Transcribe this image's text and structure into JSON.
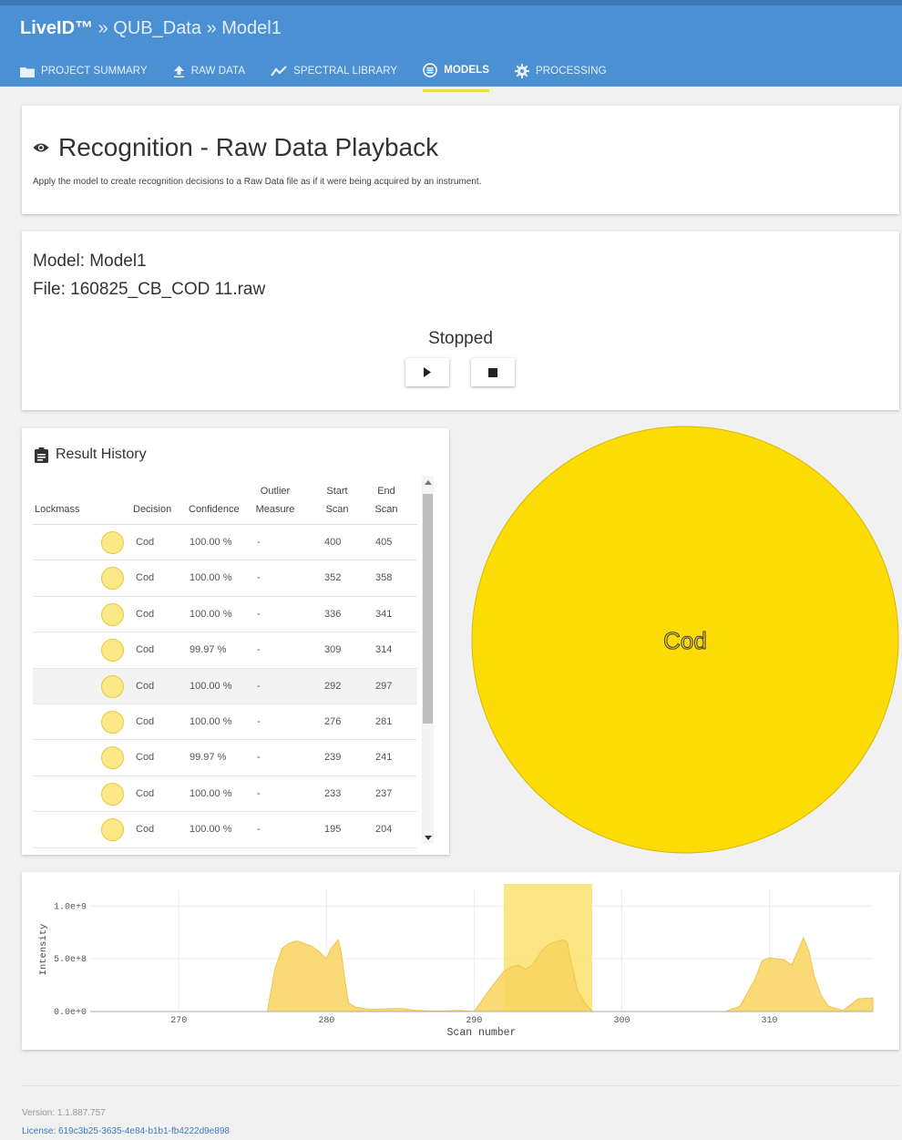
{
  "header": {
    "product": "LiveID™",
    "separator": "»",
    "breadcrumb_project": "QUB_Data",
    "breadcrumb_model": "Model1"
  },
  "nav": [
    {
      "label": "PROJECT SUMMARY",
      "icon": "folder-icon"
    },
    {
      "label": "RAW DATA",
      "icon": "upload-icon"
    },
    {
      "label": "SPECTRAL LIBRARY",
      "icon": "line-chart-icon"
    },
    {
      "label": "MODELS",
      "icon": "model-icon",
      "active": true
    },
    {
      "label": "PROCESSING",
      "icon": "gear-icon"
    }
  ],
  "page": {
    "title": "Recognition - Raw Data Playback",
    "title_icon": "eye-icon",
    "description": "Apply the model to create recognition decisions to a Raw Data file as if it were being acquired by an instrument."
  },
  "playback": {
    "model_line": "Model: Model1",
    "file_line": "File: 160825_CB_COD 11.raw",
    "status": "Stopped",
    "play_icon": "play-icon",
    "stop_icon": "stop-icon"
  },
  "results": {
    "title": "Result History",
    "title_icon": "clipboard-icon",
    "columns": {
      "lockmass": "Lockmass",
      "decision": "Decision",
      "confidence": "Confidence",
      "outlier_1": "Outlier",
      "outlier_2": "Measure",
      "start_1": "Start",
      "start_2": "Scan",
      "end_1": "End",
      "end_2": "Scan"
    },
    "rows": [
      {
        "decision": "Cod",
        "confidence": "100.00 %",
        "outlier": "-",
        "start": "400",
        "end": "405"
      },
      {
        "decision": "Cod",
        "confidence": "100.00 %",
        "outlier": "-",
        "start": "352",
        "end": "358"
      },
      {
        "decision": "Cod",
        "confidence": "100.00 %",
        "outlier": "-",
        "start": "336",
        "end": "341"
      },
      {
        "decision": "Cod",
        "confidence": "99.97 %",
        "outlier": "-",
        "start": "309",
        "end": "314"
      },
      {
        "decision": "Cod",
        "confidence": "100.00 %",
        "outlier": "-",
        "start": "292",
        "end": "297"
      },
      {
        "decision": "Cod",
        "confidence": "100.00 %",
        "outlier": "-",
        "start": "276",
        "end": "281"
      },
      {
        "decision": "Cod",
        "confidence": "99.97 %",
        "outlier": "-",
        "start": "239",
        "end": "241"
      },
      {
        "decision": "Cod",
        "confidence": "100.00 %",
        "outlier": "-",
        "start": "233",
        "end": "237"
      },
      {
        "decision": "Cod",
        "confidence": "100.00 %",
        "outlier": "-",
        "start": "195",
        "end": "204"
      }
    ]
  },
  "pie": {
    "label": "Cod",
    "value": 100,
    "color": "#fcdc04"
  },
  "chart_data": {
    "type": "area",
    "xlabel": "Scan number",
    "ylabel": "Intensity",
    "xlim": [
      264,
      317
    ],
    "ylim": [
      0,
      1150000000
    ],
    "x_ticks": [
      270,
      280,
      290,
      300,
      310
    ],
    "x_tick_labels": [
      "270",
      "280",
      "290",
      "300",
      "310"
    ],
    "y_ticks": [
      0,
      500000000,
      1000000000
    ],
    "y_tick_labels": [
      "0.0e+0",
      "5.0e+8",
      "1.0e+9"
    ],
    "highlight_range": [
      292,
      298
    ],
    "fill_color": "#f8d45f",
    "highlight_color": "#fbe26d",
    "series": [
      {
        "x": [
          264,
          272,
          274,
          275,
          276,
          276.5,
          277,
          277.5,
          278,
          279,
          279.5,
          280,
          280.3,
          280.8,
          281,
          281.3,
          281.5,
          282,
          283,
          284,
          285,
          286,
          287,
          288,
          289,
          290,
          291,
          292,
          292.5,
          293,
          293.5,
          294,
          294.5,
          295,
          295.5,
          296,
          296.3,
          296.6,
          297,
          297.5,
          298,
          299,
          300,
          302,
          304,
          306,
          307,
          308,
          309,
          309.5,
          310,
          310.5,
          311,
          311.5,
          312,
          312.3,
          312.7,
          313,
          313.5,
          314,
          315,
          316,
          317
        ],
        "y": [
          0,
          0,
          0,
          0,
          0,
          400000000,
          600000000,
          650000000,
          670000000,
          620000000,
          570000000,
          500000000,
          600000000,
          680000000,
          560000000,
          250000000,
          80000000,
          40000000,
          20000000,
          25000000,
          30000000,
          10000000,
          5000000,
          5000000,
          10000000,
          0,
          200000000,
          380000000,
          420000000,
          440000000,
          400000000,
          450000000,
          560000000,
          630000000,
          660000000,
          680000000,
          660000000,
          450000000,
          200000000,
          80000000,
          0,
          0,
          0,
          0,
          0,
          0,
          0,
          50000000,
          300000000,
          480000000,
          510000000,
          500000000,
          490000000,
          440000000,
          600000000,
          700000000,
          560000000,
          350000000,
          150000000,
          50000000,
          10000000,
          120000000,
          130000000
        ]
      }
    ]
  },
  "footer": {
    "version": "Version: 1.1.887.757",
    "license": "License: 619c3b25-3635-4e84-b1b1-fb4222d9e898"
  }
}
